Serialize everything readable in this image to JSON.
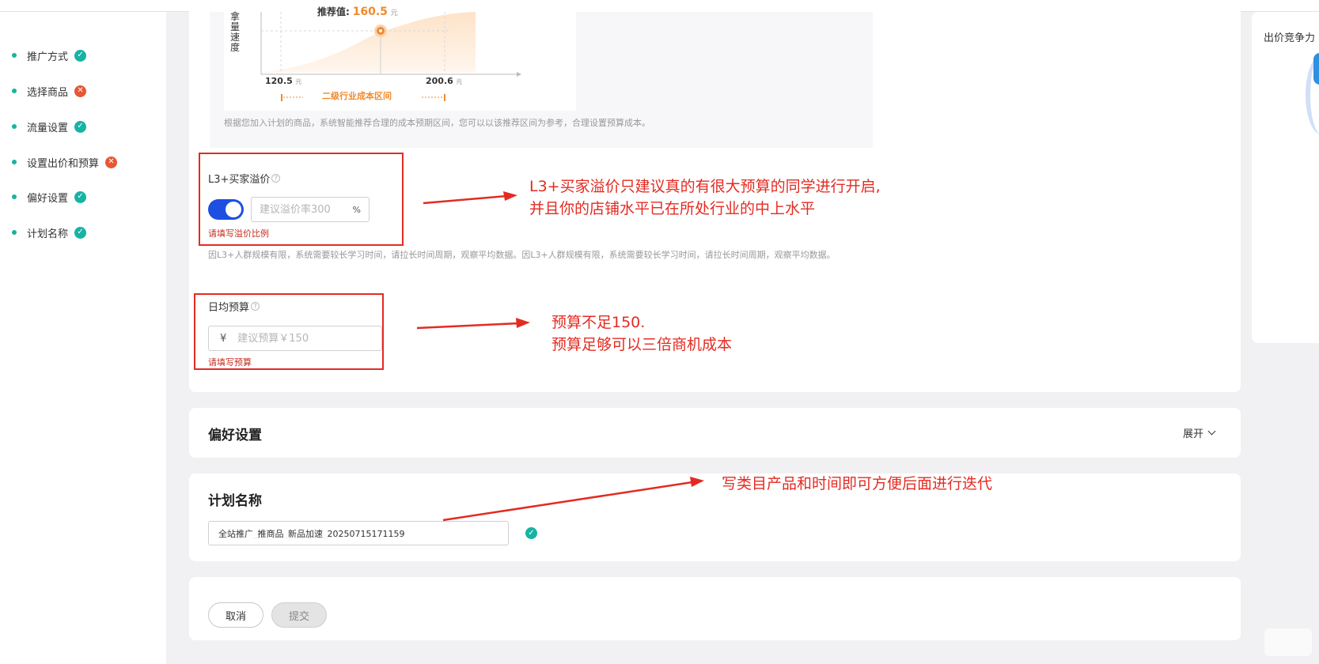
{
  "sidebar": {
    "items": [
      {
        "label": "推广方式",
        "status": "ok"
      },
      {
        "label": "选择商品",
        "status": "error"
      },
      {
        "label": "流量设置",
        "status": "ok"
      },
      {
        "label": "设置出价和预算",
        "status": "error"
      },
      {
        "label": "偏好设置",
        "status": "ok"
      },
      {
        "label": "计划名称",
        "status": "ok"
      }
    ]
  },
  "chart": {
    "y_axis_label": "拿量速度",
    "recommend_label": "推荐值:",
    "recommend_value": "160.5",
    "recommend_unit": "元",
    "low_value": "120.5",
    "high_value": "200.6",
    "unit": "元",
    "range_label": "二级行业成本区间",
    "description": "根据您加入计划的商品，系统智能推荐合理的成本预期区间，您可以以该推荐区间为参考，合理设置预算成本。"
  },
  "premium": {
    "label": "L3+买家溢价",
    "enabled": true,
    "placeholder": "建议溢价率300",
    "suffix": "%",
    "error": "请填写溢价比例",
    "hint": "因L3+人群规模有限，系统需要较长学习时间，请拉长时间周期，观察平均数据。因L3+人群规模有限，系统需要较长学习时间，请拉长时间周期，观察平均数据。"
  },
  "budget": {
    "label": "日均预算",
    "prefix": "¥",
    "placeholder": "建议预算￥150",
    "error": "请填写预算"
  },
  "preference": {
    "title": "偏好设置",
    "expand_label": "展开"
  },
  "plan_name": {
    "title": "计划名称",
    "value": "全站推广_推商品_新品加速_20250715171159"
  },
  "footer": {
    "cancel_label": "取消",
    "submit_label": "提交"
  },
  "right_panel": {
    "title": "出价竞争力"
  },
  "annotations": {
    "premium_note_line1": "L3+买家溢价只建议真的有很大预算的同学进行开启,",
    "premium_note_line2": "并且你的店铺水平已在所处行业的中上水平",
    "budget_note_line1": "预算不足150.",
    "budget_note_line2": "预算足够可以三倍商机成本",
    "plan_note": "写类目产品和时间即可方便后面进行迭代"
  },
  "colors": {
    "accent": "#1d4fe0",
    "success": "#17b3a3",
    "error": "#e85633",
    "annotation": "#e32b22",
    "chart_orange": "#f08a2c"
  }
}
